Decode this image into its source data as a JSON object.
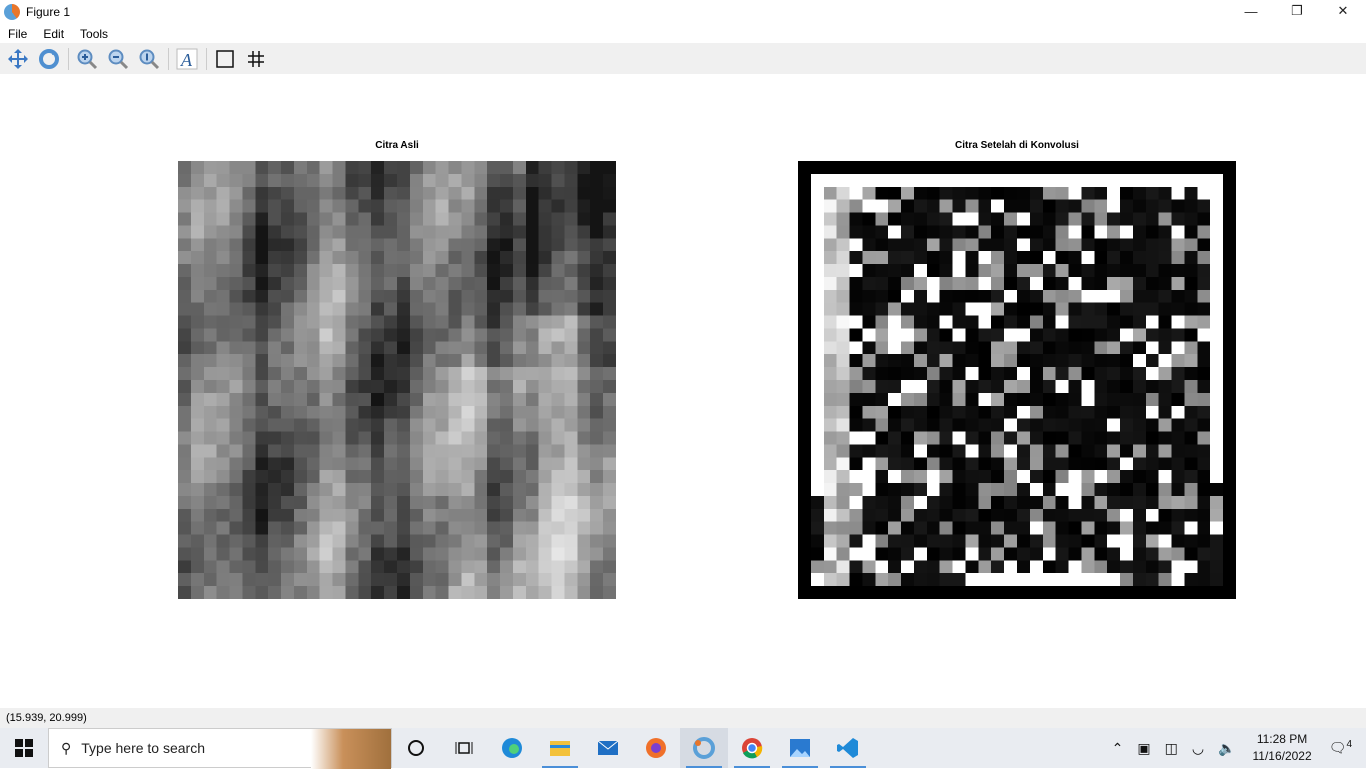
{
  "window": {
    "title": "Figure 1",
    "minimize": "—",
    "restore": "❐",
    "close": "✕"
  },
  "menu": [
    "File",
    "Edit",
    "Tools"
  ],
  "toolbar": [
    "pan-icon",
    "rotate-icon",
    "zoom-in-icon",
    "zoom-out-icon",
    "zoom-reset-icon",
    "insert-text-icon",
    "axes-box-icon",
    "grid-icon"
  ],
  "axes": [
    {
      "title": "Citra Asli"
    },
    {
      "title": "Citra Setelah di Konvolusi"
    }
  ],
  "status": {
    "coords": "(15.939, 20.999)"
  },
  "taskbar": {
    "search_placeholder": "Type here to search",
    "time": "11:28 PM",
    "date": "11/16/2022",
    "notifications": "4"
  }
}
